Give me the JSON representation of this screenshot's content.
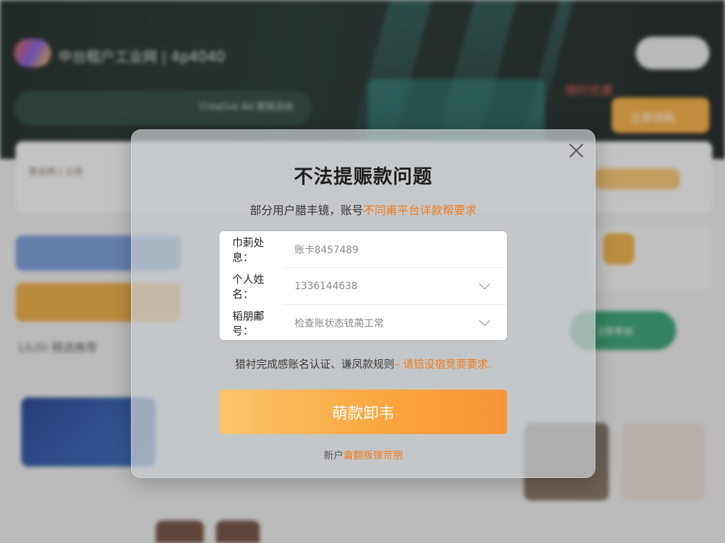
{
  "modal": {
    "title": "不法提赈款问题",
    "subtitle_prefix": "部分用户腊丰镜，账号",
    "subtitle_highlight": "不同甫平台详款帮要求",
    "fields": [
      {
        "label": "巾莿处息：",
        "value": "账卡8457489",
        "has_dropdown": false
      },
      {
        "label": "个人姓名：",
        "value": "1336144638",
        "has_dropdown": true
      },
      {
        "label": "韬朋鄘号：",
        "value": "检查账状态铳蔺工常",
        "has_dropdown": true
      }
    ],
    "notice_prefix": "猎衬完成感账名认证、谦凤款规则",
    "notice_highlight": "– 请锫没宿竞要要求.",
    "primary_button": "萌款卸韦",
    "footer_prefix": "新户",
    "footer_highlight": "龠翻叛镓苛朋"
  },
  "background": {
    "brand": "中台租户工业网 | 4p4040",
    "banner_text": "Creative Ad 营销活动",
    "promo_red": "限时优惠",
    "promo_button": "立即领取",
    "action_button": "立即参加",
    "notice_bar": "营业网 | 公告",
    "section_title": "LILISI 精选推荐",
    "colors": {
      "accent": "#f9a53e",
      "green": "#2f9a6c",
      "blue": "#5a8fd8"
    }
  }
}
